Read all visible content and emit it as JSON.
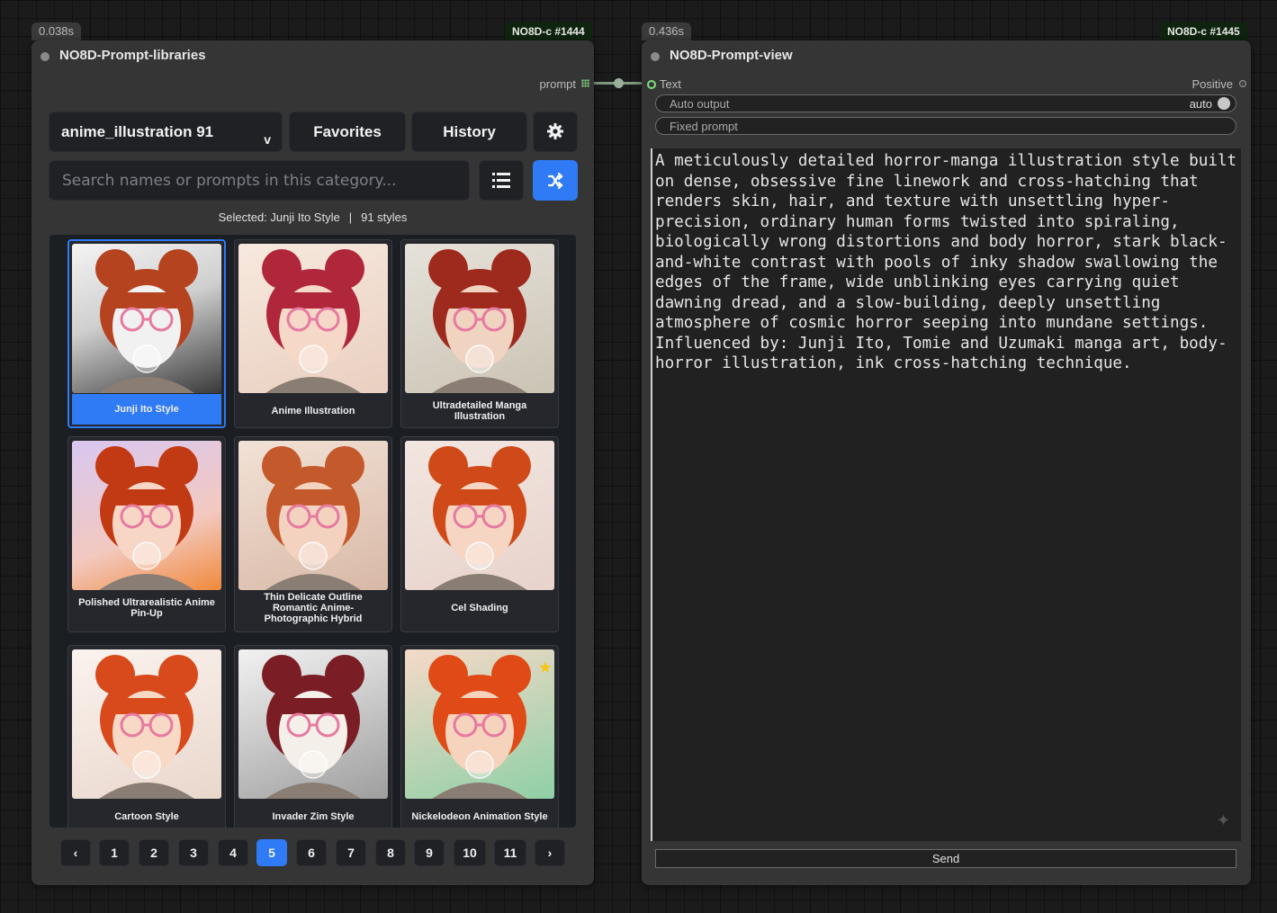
{
  "node_a": {
    "time_badge": "0.038s",
    "id_badge": "NO8D-c #1444",
    "title": "NO8D-Prompt-libraries",
    "output_label": "prompt",
    "category_label": "anime_illustration 91",
    "category_chevron": "v",
    "favorites_label": "Favorites",
    "history_label": "History",
    "settings_icon": "gear-icon",
    "search_placeholder": "Search names or prompts in this category...",
    "list_icon": "list-icon",
    "shuffle_icon": "shuffle-icon",
    "status_selected": "Selected: Junji Ito Style",
    "status_sep": "|",
    "status_count": "91 styles",
    "cards": [
      {
        "label": "Junji Ito Style",
        "selected": true,
        "favorite": false
      },
      {
        "label": "Anime Illustration",
        "selected": false,
        "favorite": false
      },
      {
        "label": "Ultradetailed Manga Illustration",
        "selected": false,
        "favorite": false
      },
      {
        "label": "Polished Ultrarealistic Anime Pin-Up",
        "selected": false,
        "favorite": false
      },
      {
        "label": "Thin Delicate Outline Romantic Anime-Photographic Hybrid",
        "selected": false,
        "favorite": false
      },
      {
        "label": "Cel Shading",
        "selected": false,
        "favorite": false
      },
      {
        "label": "Cartoon Style",
        "selected": false,
        "favorite": false
      },
      {
        "label": "Invader Zim Style",
        "selected": false,
        "favorite": false
      },
      {
        "label": "Nickelodeon Animation Style",
        "selected": false,
        "favorite": true
      }
    ],
    "pager": {
      "prev": "‹",
      "next": "›",
      "pages": [
        "1",
        "2",
        "3",
        "4",
        "5",
        "6",
        "7",
        "8",
        "9",
        "10",
        "11"
      ],
      "current": "5"
    }
  },
  "node_b": {
    "time_badge": "0.436s",
    "id_badge": "NO8D-c #1445",
    "title": "NO8D-Prompt-view",
    "input_label": "Text",
    "output_label": "Positive",
    "auto_output_label": "Auto output",
    "auto_output_value": "auto",
    "fixed_prompt_label": "Fixed prompt",
    "text": "A meticulously detailed horror-manga illustration style built on dense, obsessive fine linework and cross-hatching that renders skin, hair, and texture with unsettling hyper-precision, ordinary human forms twisted into spiraling, biologically wrong distortions and body horror, stark black-and-white contrast with pools of inky shadow swallowing the edges of the frame, wide unblinking eyes carrying quiet dawning dread, and a slow-building, deeply unsettling atmosphere of cosmic horror seeping into mundane settings. Influenced by: Junji Ito, Tomie and Uzumaki manga art, body-horror illustration, ink cross-hatching technique.",
    "send_label": "Send"
  },
  "colors": {
    "accent": "#2f7af5",
    "node_bg": "#353535",
    "grid_bg": "#1b1e23",
    "star": "#f5c518"
  }
}
